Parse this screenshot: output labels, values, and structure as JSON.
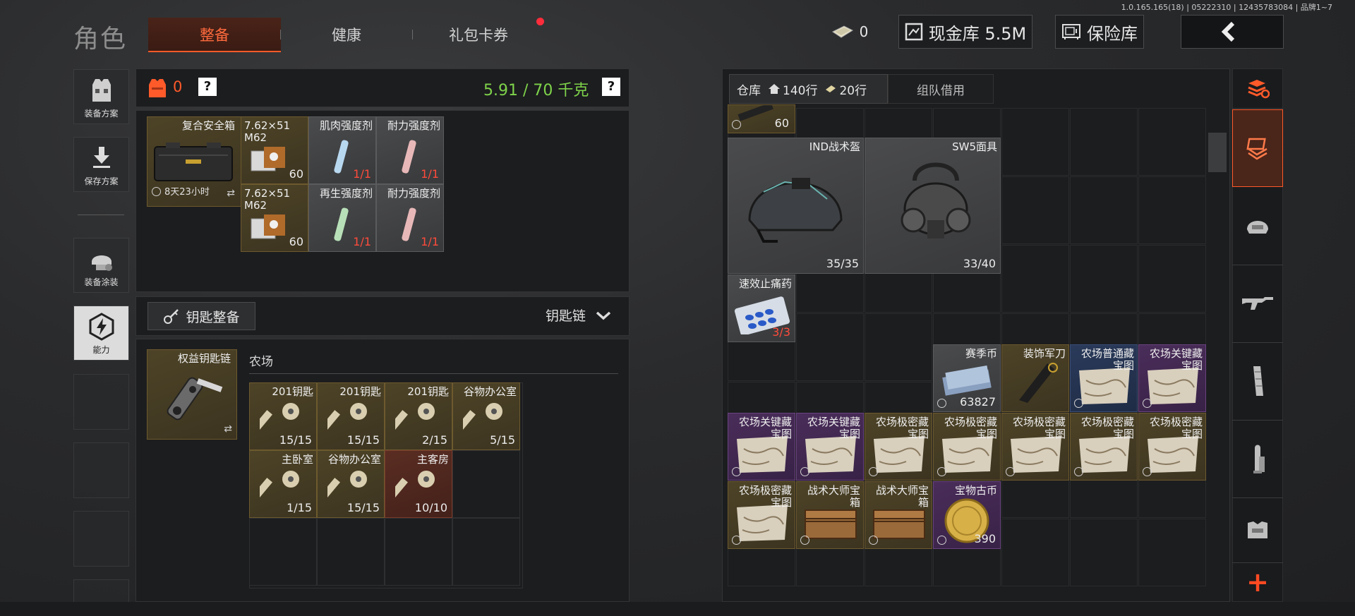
{
  "version": "1.0.165.165(18) | 05222310 | 12435783084 | 品牌1~7",
  "page_title": "角色",
  "tabs": [
    {
      "label": "整备",
      "active": true
    },
    {
      "label": "健康",
      "active": false
    },
    {
      "label": "礼包卡券",
      "active": false,
      "notification": true
    }
  ],
  "topbar": {
    "cash_count": "0",
    "cash_vault_label": "现金库 5.5M",
    "safe_label": "保险库",
    "back_icon": "chevron-left-icon"
  },
  "sidebar": [
    {
      "label": "装备方案",
      "icon": "loadout-icon"
    },
    {
      "label": "保存方案",
      "icon": "download-icon"
    },
    {
      "label": "装备涂装",
      "icon": "helmet-paint-icon"
    },
    {
      "label": "能力",
      "icon": "ability-icon",
      "active": true
    }
  ],
  "equipment": {
    "armor_value": "0",
    "weight": "5.91 / 70 千克",
    "help": "?"
  },
  "safe_box": {
    "name": "复合安全箱",
    "timer": "8天23小时"
  },
  "safe_items": [
    {
      "name": "7.62×51 M62",
      "count": "60"
    },
    {
      "name": "肌肉强度剂",
      "count": "1/1"
    },
    {
      "name": "耐力强度剂",
      "count": "1/1"
    },
    {
      "name": "7.62×51 M62",
      "count": "60"
    },
    {
      "name": "再生强度剂",
      "count": "1/1"
    },
    {
      "name": "耐力强度剂",
      "count": "1/1"
    }
  ],
  "keychain": {
    "button_label": "钥匙整备",
    "dropdown_label": "钥匙链",
    "chain_name": "权益钥匙链",
    "location": "农场",
    "keys": [
      {
        "name": "201钥匙",
        "count": "15/15"
      },
      {
        "name": "201钥匙",
        "count": "15/15"
      },
      {
        "name": "201钥匙",
        "count": "2/15"
      },
      {
        "name": "谷物办公室",
        "count": "5/15"
      },
      {
        "name": "主卧室",
        "count": "1/15"
      },
      {
        "name": "谷物办公室",
        "count": "15/15"
      },
      {
        "name": "主客房",
        "count": "10/10"
      }
    ]
  },
  "warehouse": {
    "tab_label": "仓库",
    "rows_label": "140行",
    "rows2_label": "20行",
    "team_tab": "组队借用",
    "items": [
      {
        "name": "",
        "count": "60"
      },
      {
        "name": "IND战术盔",
        "count": "35/35"
      },
      {
        "name": "SW5面具",
        "count": "33/40"
      },
      {
        "name": "速效止痛药",
        "count": "3/3"
      },
      {
        "name": "赛季币",
        "count": "63827"
      },
      {
        "name": "装饰军刀",
        "count": ""
      },
      {
        "name": "农场普通藏宝图",
        "count": ""
      },
      {
        "name": "农场关键藏宝图",
        "count": ""
      },
      {
        "name": "农场关键藏宝图",
        "count": ""
      },
      {
        "name": "农场关键藏宝图",
        "count": ""
      },
      {
        "name": "农场极密藏宝图",
        "count": ""
      },
      {
        "name": "农场极密藏宝图",
        "count": ""
      },
      {
        "name": "农场极密藏宝图",
        "count": ""
      },
      {
        "name": "农场极密藏宝图",
        "count": ""
      },
      {
        "name": "农场极密藏宝图",
        "count": ""
      },
      {
        "name": "农场极密藏宝图",
        "count": ""
      },
      {
        "name": "战术大师宝箱",
        "count": ""
      },
      {
        "name": "战术大师宝箱",
        "count": ""
      },
      {
        "name": "宝物古币",
        "count": "390"
      }
    ]
  },
  "right_tabs": [
    "stack-refresh-icon",
    "layers-icon",
    "helmet-icon",
    "rifle-icon",
    "magazine-icon",
    "bullet-icon",
    "armor-icon"
  ],
  "add_label": "+"
}
